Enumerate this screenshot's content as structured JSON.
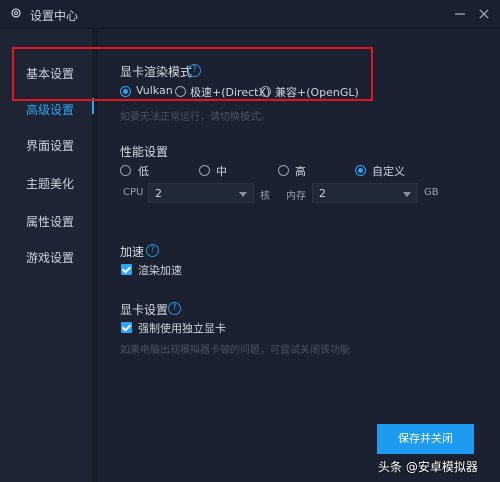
{
  "window": {
    "title": "设置中心"
  },
  "sidebar": {
    "items": [
      {
        "label": "基本设置"
      },
      {
        "label": "高级设置"
      },
      {
        "label": "界面设置"
      },
      {
        "label": "主题美化"
      },
      {
        "label": "属性设置"
      },
      {
        "label": "游戏设置"
      }
    ],
    "active_index": 1
  },
  "render_mode": {
    "title": "显卡渲染模式",
    "options": [
      "Vulkan",
      "极速+(DirectX)",
      "兼容+(OpenGL)"
    ],
    "selected": "Vulkan",
    "hint": "如要无法正常运行，请切换模式。"
  },
  "performance": {
    "title": "性能设置",
    "options": [
      "低",
      "中",
      "高",
      "自定义"
    ],
    "selected": "自定义",
    "cpu_label": "CPU",
    "cpu_value": "2",
    "cpu_unit": "核",
    "memory_label": "内存",
    "memory_value": "2",
    "memory_unit": "GB"
  },
  "acceleration": {
    "title": "加速",
    "checkbox_label": "渲染加速",
    "checked": true
  },
  "gpu": {
    "title": "显卡设置",
    "checkbox_label": "强制使用独立显卡",
    "checked": true,
    "hint": "如果电脑出现模拟器卡顿的问题，可尝试关闭该功能"
  },
  "actions": {
    "save_label": "保存并关闭"
  },
  "watermark": "头条 @安卓模拟器",
  "colors": {
    "accent": "#1d9bf0",
    "background": "#1b2130",
    "highlight_box": "#e0151f"
  }
}
